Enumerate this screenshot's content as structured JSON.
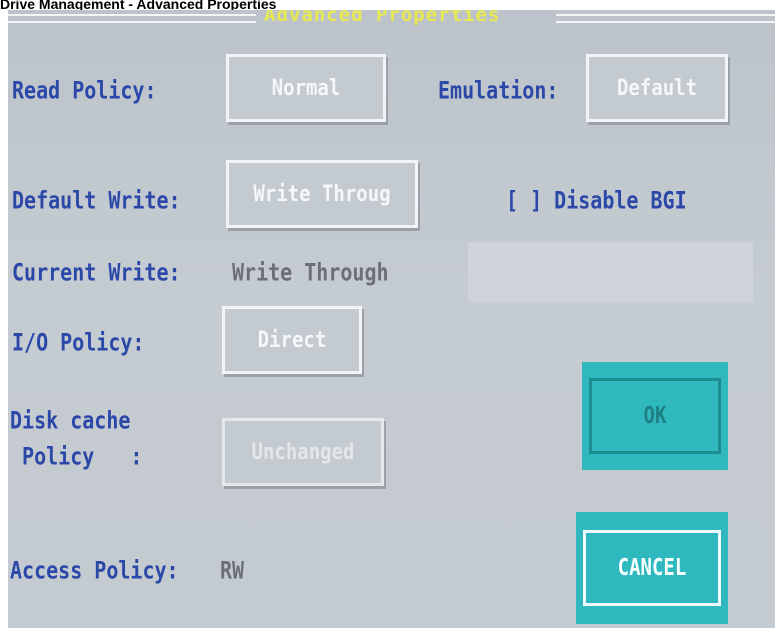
{
  "caption": "Drive Management - Advanced Properties",
  "dialog": {
    "title": "Advanced Properties",
    "read_policy": {
      "label": "Read Policy:",
      "value": "Normal"
    },
    "emulation": {
      "label": "Emulation:",
      "value": "Default"
    },
    "default_write": {
      "label": "Default Write:",
      "value": "Write Throug"
    },
    "disable_bgi": "[ ] Disable BGI",
    "current_write": {
      "label": "Current Write:",
      "value": "Write Through"
    },
    "io_policy": {
      "label": "I/O Policy:",
      "value": "Direct"
    },
    "disk_cache": {
      "label_line1": "Disk cache",
      "label_line2": " Policy   :",
      "value": "Unchanged"
    },
    "access_policy": {
      "label": "Access Policy:",
      "value": "RW"
    },
    "ok_label": "OK",
    "cancel_label": "CANCEL"
  },
  "colors": {
    "label_blue": "#2b48a8",
    "title_yellow": "#e7e94f",
    "teal": "#2fb8bd",
    "screen_gray": "#c3cad0"
  }
}
